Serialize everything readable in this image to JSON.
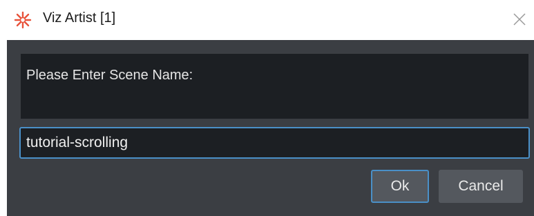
{
  "window": {
    "title": "Viz Artist [1]",
    "app_icon": "viz-artist-icon",
    "close_icon": "close-icon"
  },
  "dialog": {
    "prompt": "Please Enter Scene Name:",
    "input_value": "tutorial-scrolling",
    "ok_label": "Ok",
    "cancel_label": "Cancel"
  },
  "colors": {
    "body_bg": "#3b3e43",
    "panel_bg": "#1c1f23",
    "accent": "#4a90c8",
    "button_bg": "#54585e",
    "icon_color": "#e8523a"
  }
}
